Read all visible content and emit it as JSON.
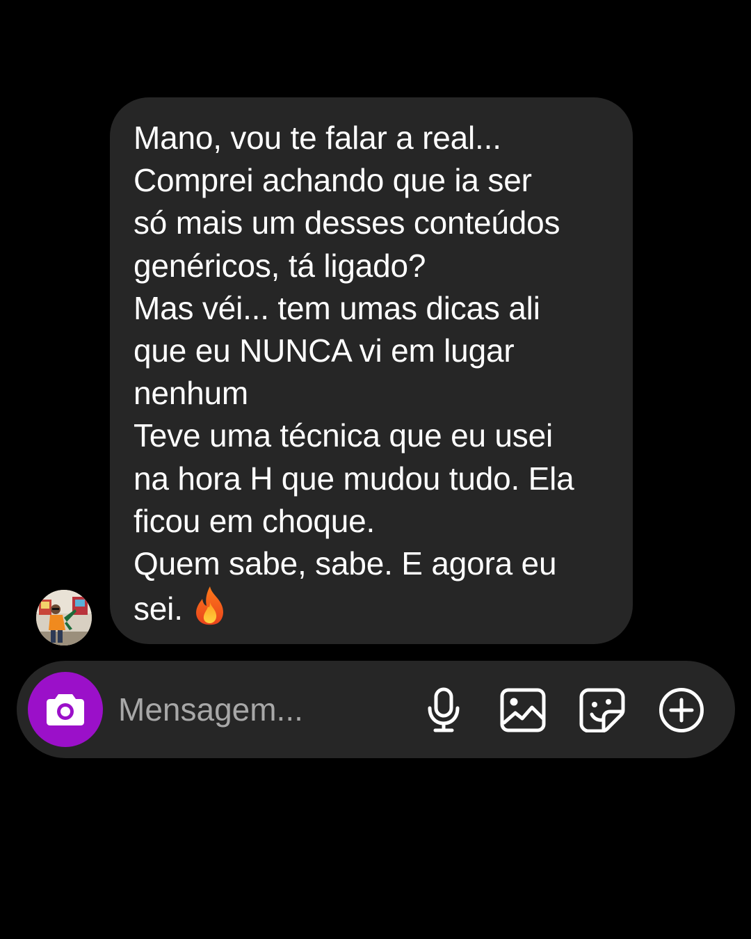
{
  "thread": {
    "message": {
      "lines": [
        "Mano, vou te falar a real...",
        "Comprei achando que ia ser",
        "só mais um desses conteúdos",
        "genéricos, tá ligado?",
        "Mas véi... tem umas dicas ali",
        "que eu NUNCA vi em lugar",
        "nenhum",
        "Teve uma técnica que eu usei",
        "na hora H que mudou tudo. Ela",
        "ficou em choque.",
        "Quem sabe, sabe. E agora eu",
        "sei."
      ],
      "emoji": "fire-emoji"
    },
    "sender_avatar": "avatar-photo"
  },
  "composer": {
    "placeholder": "Mensagem...",
    "camera_icon": "camera-icon",
    "mic_icon": "microphone-icon",
    "gallery_icon": "image-icon",
    "sticker_icon": "sticker-icon",
    "more_icon": "plus-circle-icon"
  },
  "colors": {
    "background": "#000000",
    "bubble": "#262626",
    "composer": "#262626",
    "camera_button": "#9b10c9",
    "placeholder_text": "#a8a8a8",
    "text": "#ffffff"
  }
}
